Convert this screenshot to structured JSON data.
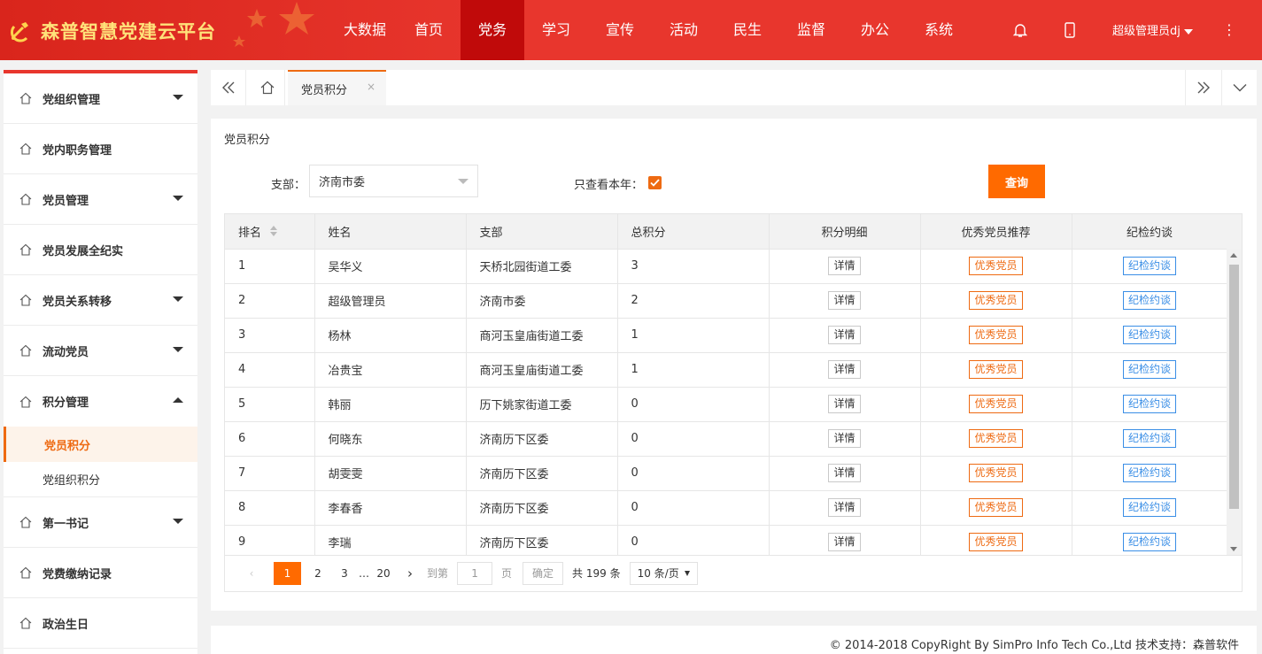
{
  "header": {
    "app_title": "森普智慧党建云平台",
    "nav": [
      "大数据",
      "首页",
      "党务",
      "学习",
      "宣传",
      "活动",
      "民生",
      "监督",
      "办公",
      "系统"
    ],
    "active_nav_index": 2,
    "user_name": "超级管理员dj",
    "icons": [
      "bell-icon",
      "mobile-icon",
      "more-icon"
    ]
  },
  "sidebar": {
    "items": [
      {
        "label": "党组织管理",
        "arrow": "down"
      },
      {
        "label": "党内职务管理",
        "arrow": ""
      },
      {
        "label": "党员管理",
        "arrow": "down"
      },
      {
        "label": "党员发展全纪实",
        "arrow": ""
      },
      {
        "label": "党员关系转移",
        "arrow": "down"
      },
      {
        "label": "流动党员",
        "arrow": "down"
      },
      {
        "label": "积分管理",
        "arrow": "up"
      }
    ],
    "sub_items": [
      "党员积分",
      "党组织积分"
    ],
    "items_after": [
      {
        "label": "第一书记",
        "arrow": "down"
      },
      {
        "label": "党费缴纳记录",
        "arrow": ""
      },
      {
        "label": "政治生日",
        "arrow": ""
      }
    ]
  },
  "tabs": {
    "active_tab": "党员积分",
    "close": "×"
  },
  "panel": {
    "title": "党员积分",
    "branch_label": "支部：",
    "branch_value": "济南市委",
    "this_year_label": "只查看本年：",
    "this_year_checked": true,
    "query_button": "查询"
  },
  "table": {
    "headers": [
      "排名",
      "姓名",
      "支部",
      "总积分",
      "积分明细",
      "优秀党员推荐",
      "纪检约谈"
    ],
    "detail_label": "详情",
    "excellent_label": "优秀党员",
    "talk_label": "纪检约谈",
    "rows": [
      {
        "rank": "1",
        "name": "吴华义",
        "branch": "天桥北园街道工委",
        "score": "3"
      },
      {
        "rank": "2",
        "name": "超级管理员",
        "branch": "济南市委",
        "score": "2"
      },
      {
        "rank": "3",
        "name": "杨林",
        "branch": "商河玉皇庙街道工委",
        "score": "1"
      },
      {
        "rank": "4",
        "name": "冶贵宝",
        "branch": "商河玉皇庙街道工委",
        "score": "1"
      },
      {
        "rank": "5",
        "name": "韩丽",
        "branch": "历下姚家街道工委",
        "score": "0"
      },
      {
        "rank": "6",
        "name": "何晓东",
        "branch": "济南历下区委",
        "score": "0"
      },
      {
        "rank": "7",
        "name": "胡雯雯",
        "branch": "济南历下区委",
        "score": "0"
      },
      {
        "rank": "8",
        "name": "李春香",
        "branch": "济南历下区委",
        "score": "0"
      },
      {
        "rank": "9",
        "name": "李瑞",
        "branch": "济南历下区委",
        "score": "0"
      }
    ]
  },
  "pagination": {
    "prev": "‹",
    "pages": [
      "1",
      "2",
      "3"
    ],
    "current": "1",
    "ellipsis": "…",
    "last": "20",
    "next": "›",
    "goto_label": "到第",
    "goto_value": "1",
    "page_unit": "页",
    "confirm": "确定",
    "total": "共 199 条",
    "page_size": "10 条/页"
  },
  "footer": {
    "text": "© 2014-2018 CopyRight By SimPro Info Tech Co.,Ltd 技术支持：森普软件"
  }
}
